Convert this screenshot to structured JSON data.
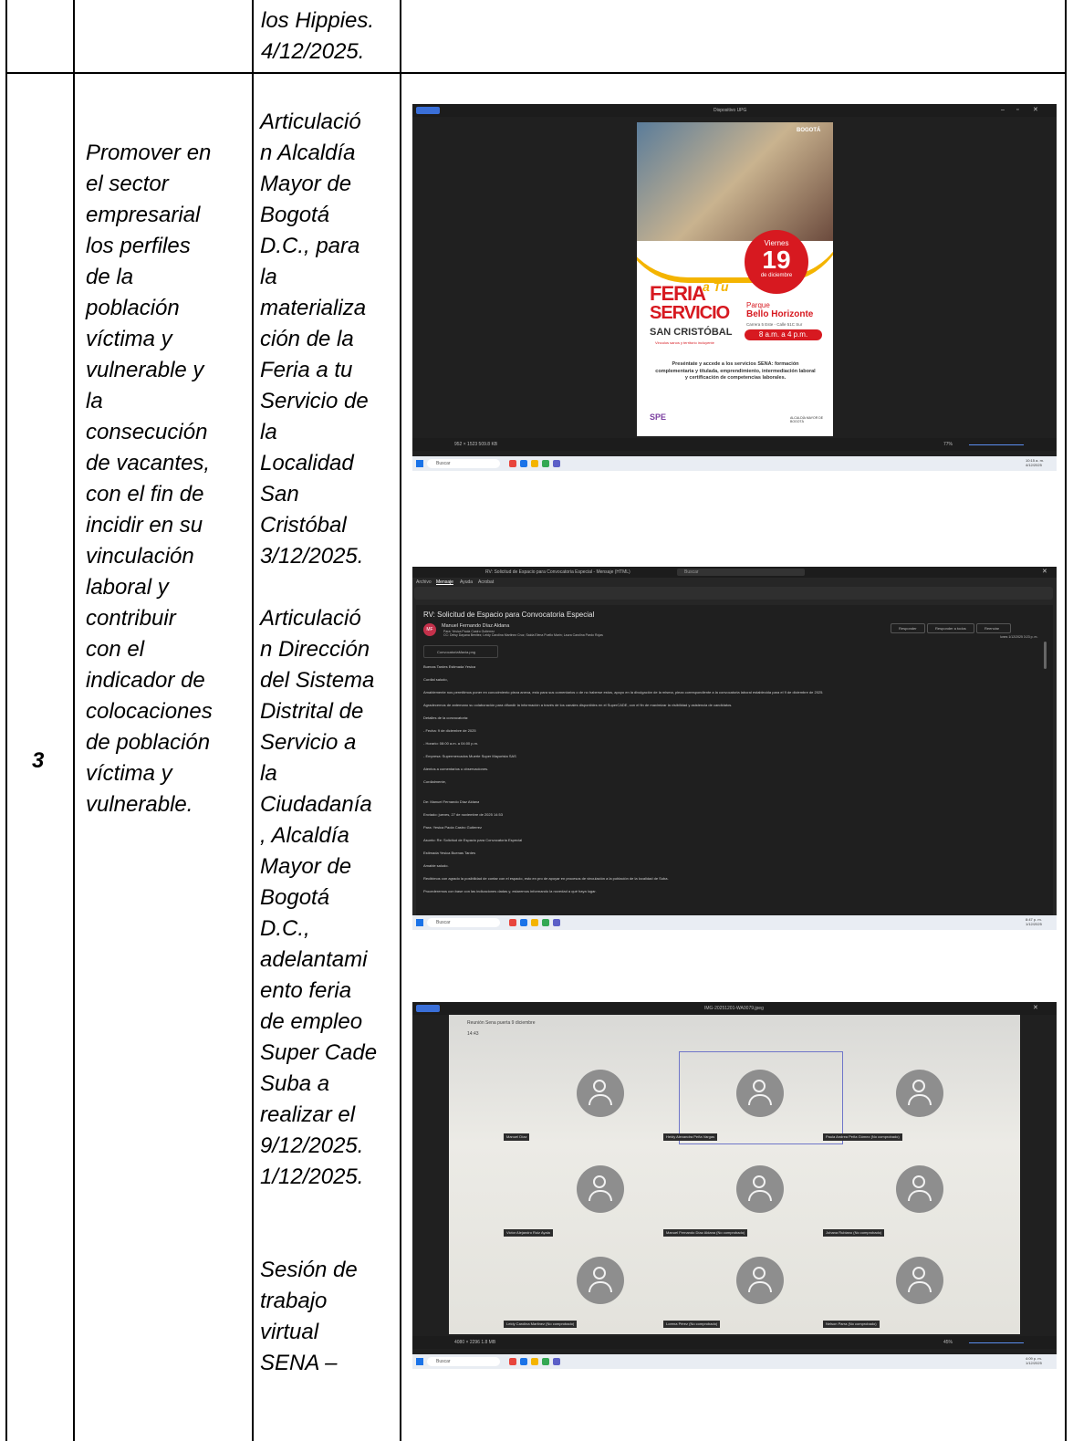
{
  "row_top": {
    "activity_lines": [
      "los Hippies.",
      "4/12/2025."
    ]
  },
  "row_main": {
    "number": "3",
    "objective_lines": [
      "Promover en",
      "el sector",
      "empresarial",
      "los perfiles",
      "de la",
      "población",
      "víctima y",
      "vulnerable y",
      "la",
      "consecución",
      "de vacantes,",
      "con el fin de",
      "incidir en su",
      "vinculación",
      "laboral y",
      "contribuir",
      "con el",
      "indicador de",
      "colocaciones",
      "de población",
      "víctima y",
      "vulnerable."
    ],
    "activity_lines": [
      "Articulació",
      "n Alcaldía",
      "Mayor de",
      "Bogotá",
      "D.C., para",
      "la",
      "materializa",
      "ción de la",
      "Feria a tu",
      "Servicio de",
      "la",
      "Localidad",
      "San",
      "Cristóbal",
      "3/12/2025.",
      "",
      "Articulació",
      "n Dirección",
      "del Sistema",
      "Distrital de",
      "Servicio a",
      "la",
      "Ciudadanía",
      ", Alcaldía",
      "Mayor de",
      "Bogotá",
      "D.C.,",
      "adelantami",
      "ento feria",
      "de empleo",
      "Super Cade",
      "Suba a",
      "realizar el",
      "9/12/2025.",
      "1/12/2025.",
      "",
      "",
      "Sesión de",
      "trabajo",
      "virtual",
      "SENA –"
    ]
  },
  "evidence_1": {
    "window_title": "Dispositivo UPG",
    "poster_badge": "Viernes",
    "poster_day": "19",
    "poster_month": "de diciembre",
    "poster_brand": "BOGOTÁ",
    "poster_title_1": "FERIA",
    "poster_title_2": "a Tu",
    "poster_title_3": "SERVICIO",
    "poster_locality": "SAN CRISTÓBAL",
    "poster_tagline": "Vinculos sanos y territorio incluyente",
    "poster_place_1": "Parque",
    "poster_place_2": "Bello Horizonte",
    "poster_address": "Carrera 5 Este - Calle 51C Sur",
    "poster_time": "8 a.m. a 4 p.m.",
    "poster_body": "Preséntate y accede a los servicios SENA: formación complementaria y titulada, emprendimiento, intermediación laboral y certificación de competencias laborales.",
    "poster_footer_logo": "SPE",
    "poster_footer_right": "ALCALDÍA MAYOR DE BOGOTÁ",
    "status_left": "952 × 1523   509.8 KB",
    "zoom": "77%",
    "clock": "10:15 a. m. 4/12/2025",
    "search": "Buscar"
  },
  "evidence_2": {
    "window_title": "RV: Solicitud de Espacio para Convocatoria Especial - Mensaje (HTML)",
    "search": "Buscar",
    "menu": [
      "Archivo",
      "Mensaje",
      "Ayuda",
      "Acrobat"
    ],
    "subject": "RV: Solicitud de Espacio para Convocatoria Especial",
    "sender_initials": "MF",
    "sender": "Manuel Fernando Díaz Aldana",
    "to": "Para: Yesica Paola Castro Gutierrez",
    "cc": "CC: Deisy Dayana Benitez; Leidy Carolina Martinez Cruz; Saida Elena Puello Marin; Laura Carolina Pardo Rojas",
    "attachment": "ConvocatoriaMaxia.png",
    "reply": "Responder",
    "reply_all": "Responder a todos",
    "forward": "Reenviar",
    "date": "lunes 1/12/2025 3:23 p. m.",
    "body_lines": [
      "Buenas Tardes Estimada Yesica",
      "Cordial saludo,",
      "Amablemente nos permitimos poner en conocimiento pieza anexa, esto para sus comentarios o de no haberse estos, apoyo en la divulgación de la misma, pieza correspondiente a la convocatoria laboral establecida para el 9 de diciembre de 2025.",
      "Agradecemos de antemano su colaboración para difundir la información a través de los canales disponibles en el SuperCADE, con el fin de maximizar la visibilidad y asistencia de candidatos.",
      "Detalles de la convocatoria:",
      "- Fecha: 9 de diciembre de 2025",
      "- Horario: 08:00 a.m. a 04:00 p.m.",
      "- Empresa: Supermercados Muerte Super Mayorista SAS",
      "Atentos a comentarios u observaciones.",
      "Cordialmente,",
      "De: Manuel Fernando Díaz Aldana",
      "Enviado: jueves, 27 de noviembre de 2025 14:53",
      "Para: Yesica Paola Castro Gutierrez",
      "Asunto: Re: Solicitud de Espacio para Convocatoria Especial",
      "Estimada Yesica Buenas Tardes",
      "Amable saludo.",
      "Recibimos con agrado la posibilidad de contar con el espacio, esto en pro de apoyar en procesos de vinculación a la población de la localidad de Suba.",
      "Procederemos con base con las indicaciones dadas y, estaremos informando la novedad a qué haya lugar."
    ],
    "clock": "8:47 p. m. 1/12/2025"
  },
  "evidence_3": {
    "window_title": "IMG-20251201-WA0079.jpeg",
    "meeting_title": "Reunión Sena puerta 9 diciembre",
    "timer": "14:43",
    "participants": [
      "Manuel Díaz",
      "Heidy Alexandra Peña Vargas",
      "Paula Andrea Peña Gómez (No comprobado)",
      "Victor Alejandro Ruiz Ayala",
      "Manuel Fernando Díaz Aldana (No comprobado)",
      "Johana Rubiano (No comprobado)",
      "Leidy Carolina Martinez (No comprobado)",
      "Lorena Pérez (No comprobado)",
      "Nelson Parra (No comprobado)"
    ],
    "status_left": "4080 × 2296   1.8 MB",
    "zoom": "45%",
    "clock": "4:09 p. m. 1/12/2025",
    "search": "Buscar"
  },
  "colors": {
    "window_dark": "#1f1f1f",
    "poster_red": "#d71920",
    "poster_yellow": "#f4b400",
    "taskbar": "#e9edf3"
  }
}
